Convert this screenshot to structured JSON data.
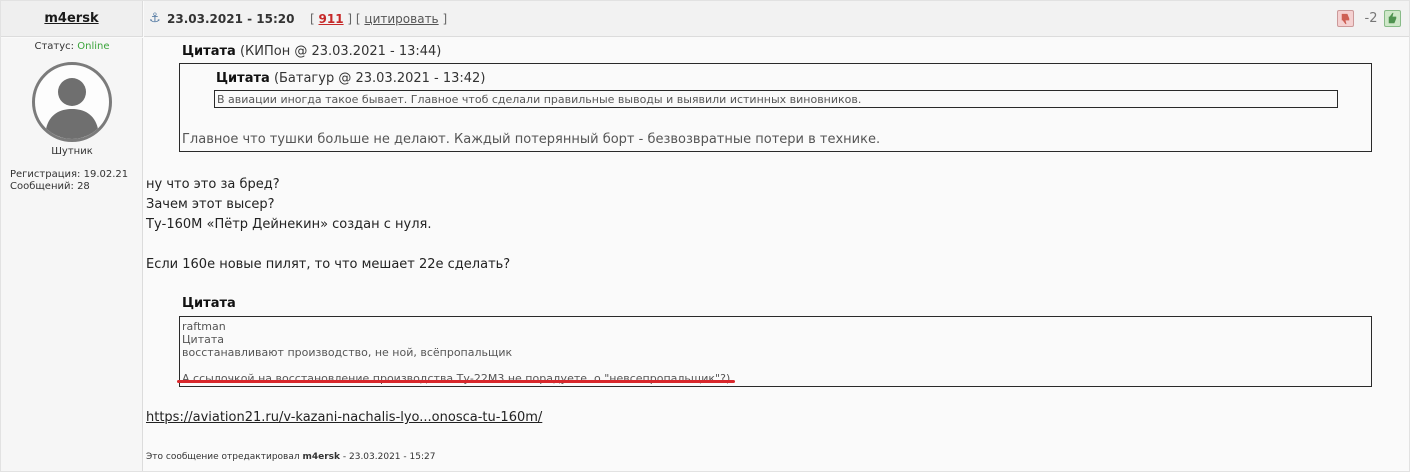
{
  "author": {
    "username": "m4ersk",
    "status_label": "Статус:",
    "status_value": "Online",
    "rank": "Шутник",
    "reg_label": "Регистрация:",
    "reg_date": "19.02.21",
    "posts_label": "Сообщений:",
    "posts_count": "28"
  },
  "post_header": {
    "date": "23.03.2021 - 15:20",
    "bracket_open": "[",
    "number": "911",
    "bracket_mid": "] [",
    "cite_label": "цитировать",
    "bracket_close": "]",
    "rating": "-2"
  },
  "quote_outer": {
    "label": "Цитата",
    "meta": "(КИПон @ 23.03.2021 - 13:44)",
    "text": "Главное что тушки больше не делают. Каждый потерянный борт - безвозвратные потери в технике."
  },
  "quote_inner": {
    "label": "Цитата",
    "meta": "(Батагур @ 23.03.2021 - 13:42)",
    "text": "В авиации иногда такое бывает. Главное чтоб сделали правильные выводы и выявили истинных виновников."
  },
  "body_lines": [
    "ну что это за бред?",
    "Зачем этот высер?",
    "Ту-160М «Пётр Дейнекин» создан с нуля.",
    "",
    "Если 160е новые пилят, то что мешает 22е сделать?"
  ],
  "quote_third": {
    "label": "Цитата",
    "lines": [
      "raftman",
      "Цитата",
      "восстанавливают производство, не ной, всёпропальщик",
      "",
      "А ссылочкой на восстановление производства Ту-22М3 не порадуете, о \"невсепропальщик\"?)"
    ]
  },
  "link_text": "https://aviation21.ru/v-kazani-nachalis-lyo...onosca-tu-160m/",
  "edited": {
    "prefix": "Это сообщение отредактировал",
    "editor": "m4ersk",
    "suffix": "- 23.03.2021 - 15:27"
  },
  "colors": {
    "online": "#3aa43a",
    "post_number": "#c62828",
    "highlight_underline": "#d8272b"
  },
  "icons": {
    "anchor": "anchor-icon",
    "rate_down": "thumbs-down-icon",
    "rate_up": "thumbs-up-icon",
    "avatar": "user-silhouette-icon"
  }
}
